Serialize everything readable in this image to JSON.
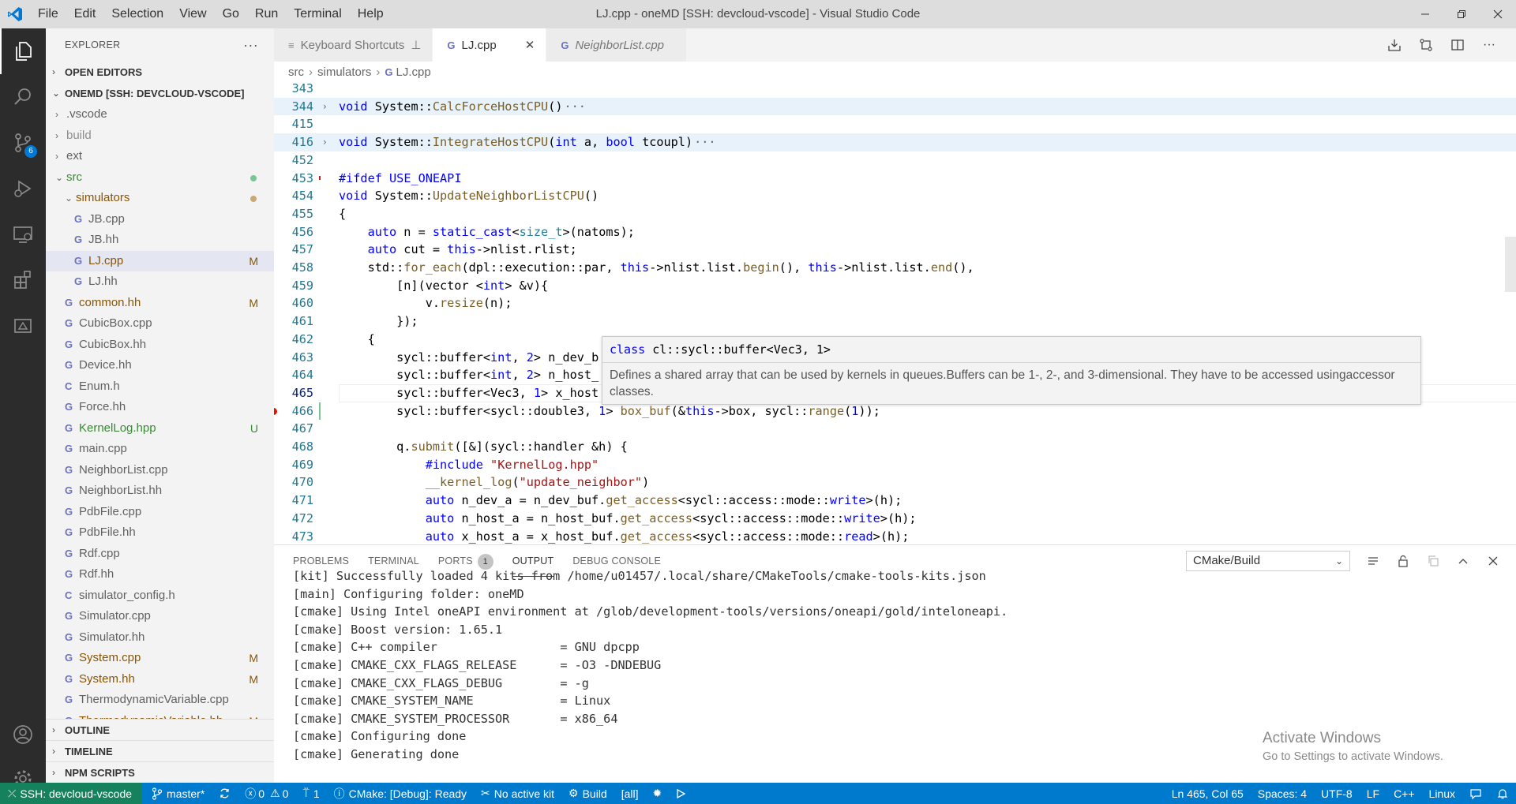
{
  "window": {
    "title": "LJ.cpp - oneMD [SSH: devcloud-vscode] - Visual Studio Code",
    "menu": [
      "File",
      "Edit",
      "Selection",
      "View",
      "Go",
      "Run",
      "Terminal",
      "Help"
    ]
  },
  "activity_bar": {
    "scm_badge": "6"
  },
  "explorer": {
    "title": "EXPLORER",
    "more": "···",
    "open_editors": "OPEN EDITORS",
    "workspace": "ONEMD [SSH: DEVCLOUD-VSCODE]",
    "items": [
      {
        "label": ".vscode",
        "type": "folder",
        "depth": 0,
        "color": "#616161",
        "status": ""
      },
      {
        "label": "build",
        "type": "folder",
        "depth": 0,
        "color": "#8e8e90",
        "status": ""
      },
      {
        "label": "ext",
        "type": "folder",
        "depth": 0,
        "color": "#616161",
        "status": ""
      },
      {
        "label": "src",
        "type": "folder-open",
        "depth": 0,
        "color": "#388a34",
        "status": "dot",
        "status_color": "#73c991"
      },
      {
        "label": "simulators",
        "type": "folder-open",
        "depth": 1,
        "color": "#895503",
        "status": "dot",
        "status_color": "#c9a973"
      },
      {
        "label": "JB.cpp",
        "type": "cpp",
        "depth": 2,
        "color": "#616161",
        "status": ""
      },
      {
        "label": "JB.hh",
        "type": "cpp",
        "depth": 2,
        "color": "#616161",
        "status": ""
      },
      {
        "label": "LJ.cpp",
        "type": "cpp",
        "depth": 2,
        "color": "#895503",
        "status": "M",
        "status_color": "#895503",
        "selected": true
      },
      {
        "label": "LJ.hh",
        "type": "cpp",
        "depth": 2,
        "color": "#616161",
        "status": ""
      },
      {
        "label": "common.hh",
        "type": "cpp",
        "depth": 1,
        "color": "#895503",
        "status": "M",
        "status_color": "#895503"
      },
      {
        "label": "CubicBox.cpp",
        "type": "cpp",
        "depth": 1,
        "color": "#616161",
        "status": ""
      },
      {
        "label": "CubicBox.hh",
        "type": "cpp",
        "depth": 1,
        "color": "#616161",
        "status": ""
      },
      {
        "label": "Device.hh",
        "type": "cpp",
        "depth": 1,
        "color": "#616161",
        "status": ""
      },
      {
        "label": "Enum.h",
        "type": "c",
        "depth": 1,
        "color": "#616161",
        "status": ""
      },
      {
        "label": "Force.hh",
        "type": "cpp",
        "depth": 1,
        "color": "#616161",
        "status": ""
      },
      {
        "label": "KernelLog.hpp",
        "type": "cpp",
        "depth": 1,
        "color": "#388a34",
        "status": "U",
        "status_color": "#388a34"
      },
      {
        "label": "main.cpp",
        "type": "cpp",
        "depth": 1,
        "color": "#616161",
        "status": ""
      },
      {
        "label": "NeighborList.cpp",
        "type": "cpp",
        "depth": 1,
        "color": "#616161",
        "status": ""
      },
      {
        "label": "NeighborList.hh",
        "type": "cpp",
        "depth": 1,
        "color": "#616161",
        "status": ""
      },
      {
        "label": "PdbFile.cpp",
        "type": "cpp",
        "depth": 1,
        "color": "#616161",
        "status": ""
      },
      {
        "label": "PdbFile.hh",
        "type": "cpp",
        "depth": 1,
        "color": "#616161",
        "status": ""
      },
      {
        "label": "Rdf.cpp",
        "type": "cpp",
        "depth": 1,
        "color": "#616161",
        "status": ""
      },
      {
        "label": "Rdf.hh",
        "type": "cpp",
        "depth": 1,
        "color": "#616161",
        "status": ""
      },
      {
        "label": "simulator_config.h",
        "type": "c",
        "depth": 1,
        "color": "#616161",
        "status": ""
      },
      {
        "label": "Simulator.cpp",
        "type": "cpp",
        "depth": 1,
        "color": "#616161",
        "status": ""
      },
      {
        "label": "Simulator.hh",
        "type": "cpp",
        "depth": 1,
        "color": "#616161",
        "status": ""
      },
      {
        "label": "System.cpp",
        "type": "cpp",
        "depth": 1,
        "color": "#895503",
        "status": "M",
        "status_color": "#895503"
      },
      {
        "label": "System.hh",
        "type": "cpp",
        "depth": 1,
        "color": "#895503",
        "status": "M",
        "status_color": "#895503"
      },
      {
        "label": "ThermodynamicVariable.cpp",
        "type": "cpp",
        "depth": 1,
        "color": "#616161",
        "status": ""
      },
      {
        "label": "ThermodynamicVariable.hh",
        "type": "cpp",
        "depth": 1,
        "color": "#895503",
        "status": "M",
        "status_color": "#895503"
      }
    ],
    "bottom_sections": [
      "OUTLINE",
      "TIMELINE",
      "NPM SCRIPTS"
    ]
  },
  "tabs": [
    {
      "label": "Keyboard Shortcuts",
      "icon": "≡",
      "active": false,
      "italic": false,
      "pin": true
    },
    {
      "label": "LJ.cpp",
      "icon": "G",
      "active": true,
      "italic": false,
      "close": "✕"
    },
    {
      "label": "NeighborList.cpp",
      "icon": "G",
      "active": false,
      "italic": true
    }
  ],
  "breadcrumb": {
    "parts": [
      "src",
      "simulators",
      "LJ.cpp"
    ]
  },
  "code": {
    "lines": [
      {
        "n": "343",
        "html": ""
      },
      {
        "n": "344",
        "fold": "›",
        "hl": true,
        "ellipsis": true,
        "html": "<span class='kw'>void</span> System::<span class='fn'>CalcForceHostCPU</span>()"
      },
      {
        "n": "415",
        "html": ""
      },
      {
        "n": "416",
        "fold": "›",
        "hl": true,
        "ellipsis": true,
        "html": "<span class='kw'>void</span> System::<span class='fn'>IntegrateHostCPU</span>(<span class='kw'>int</span> a, <span class='kw'>bool</span> tcoupl)"
      },
      {
        "n": "452",
        "html": ""
      },
      {
        "n": "453",
        "html": "<span class='pp'>#ifdef</span> <span class='pp'>USE_ONEAPI</span>"
      },
      {
        "n": "454",
        "html": "<span class='kw'>void</span> System::<span class='fn'>UpdateNeighborListCPU</span>()"
      },
      {
        "n": "455",
        "html": "{"
      },
      {
        "n": "456",
        "html": "    <span class='kw'>auto</span> n = <span class='kw'>static_cast</span>&lt;<span class='ty'>size_t</span>&gt;(natoms);"
      },
      {
        "n": "457",
        "html": "    <span class='kw'>auto</span> cut = <span class='kw'>this</span>-&gt;nlist.rlist;"
      },
      {
        "n": "458",
        "html": "    std::<span class='fn'>for_each</span>(dpl::execution::par, <span class='kw'>this</span>-&gt;nlist.list.<span class='fn'>begin</span>(), <span class='kw'>this</span>-&gt;nlist.list.<span class='fn'>end</span>(),"
      },
      {
        "n": "459",
        "html": "        [n](vector &lt;<span class='kw'>int</span>&gt; &amp;v){"
      },
      {
        "n": "460",
        "html": "            v.<span class='fn'>resize</span>(n);"
      },
      {
        "n": "461",
        "html": "        });"
      },
      {
        "n": "462",
        "html": "    {"
      },
      {
        "n": "463",
        "html": "        sycl::buffer&lt;<span class='kw'>int</span>, <span class='kw'>2</span>&gt; n_dev_b"
      },
      {
        "n": "464",
        "html": "        sycl::buffer&lt;<span class='kw'>int</span>, <span class='kw'>2</span>&gt; n_host_"
      },
      {
        "n": "465",
        "cur": true,
        "html": "        sycl::buffer&lt;Vec3, <span class='kw'>1</span>&gt; x_host"
      },
      {
        "n": "466",
        "bp": true,
        "html": "        sycl::buffer&lt;sycl::double3, <span class='kw'>1</span>&gt; <span class='fn'>box_buf</span>(&amp;<span class='kw'>this</span>-&gt;box, sycl::<span class='fn'>range</span>(<span class='kw'>1</span>));"
      },
      {
        "n": "467",
        "html": ""
      },
      {
        "n": "468",
        "html": "        q.<span class='fn'>submit</span>([&amp;](sycl::handler &amp;h) {"
      },
      {
        "n": "469",
        "html": "            <span class='pp'>#include</span> <span class='st'>\"KernelLog.hpp\"</span>"
      },
      {
        "n": "470",
        "html": "            <span class='fn'>__kernel_log</span>(<span class='st'>\"update_neighbor\"</span>)"
      },
      {
        "n": "471",
        "html": "            <span class='kw'>auto</span> n_dev_a = n_dev_buf.<span class='fn'>get_access</span>&lt;sycl::access::mode::<span class='kw'>write</span>&gt;(h);"
      },
      {
        "n": "472",
        "html": "            <span class='kw'>auto</span> n_host_a = n_host_buf.<span class='fn'>get_access</span>&lt;sycl::access::mode::<span class='kw'>write</span>&gt;(h);"
      },
      {
        "n": "473",
        "html": "            <span class='kw'>auto</span> x_host_a = x_host_buf.<span class='fn'>get_access</span>&lt;sycl::access::mode::<span class='kw'>read</span>&gt;(h);"
      }
    ]
  },
  "hover": {
    "sig_kw": "class",
    "sig": "cl::sycl::buffer<Vec3, 1>",
    "doc": "Defines a shared array that can be used by kernels in queues.Buffers can be 1-, 2-, and 3-dimensional. They have to be accessed usingaccessor classes."
  },
  "panel": {
    "tabs": [
      {
        "label": "PROBLEMS"
      },
      {
        "label": "TERMINAL"
      },
      {
        "label": "PORTS",
        "badge": "1"
      },
      {
        "label": "OUTPUT",
        "active": true
      },
      {
        "label": "DEBUG CONSOLE"
      }
    ],
    "select": "CMake/Build",
    "log": [
      "[kit] Successfully loaded 4 kits from /home/u01457/.local/share/CMakeTools/cmake-tools-kits.json",
      "[main] Configuring folder: oneMD",
      "[cmake] Using Intel oneAPI environment at /glob/development-tools/versions/oneapi/gold/inteloneapi.",
      "[cmake] Boost version: 1.65.1",
      "[cmake] C++ compiler                 = GNU dpcpp",
      "[cmake] CMAKE_CXX_FLAGS_RELEASE      = -O3 -DNDEBUG",
      "[cmake] CMAKE_CXX_FLAGS_DEBUG        = -g",
      "[cmake] CMAKE_SYSTEM_NAME            = Linux",
      "[cmake] CMAKE_SYSTEM_PROCESSOR       = x86_64",
      "[cmake] Configuring done",
      "[cmake] Generating done"
    ]
  },
  "watermark": {
    "title": "Activate Windows",
    "sub": "Go to Settings to activate Windows."
  },
  "statusbar": {
    "remote": "SSH: devcloud-vscode",
    "branch": "master*",
    "errors": "0",
    "warnings": "0",
    "ports": "1",
    "cmake": "CMake: [Debug]: Ready",
    "kit": "No active kit",
    "build": "Build",
    "target": "[all]",
    "position": "Ln 465, Col 65",
    "spaces": "Spaces: 4",
    "encoding": "UTF-8",
    "eol": "LF",
    "language": "C++",
    "os": "Linux"
  },
  "colors": {
    "accent": "#007acc",
    "remote": "#16825d",
    "activity": "#2c2c2c"
  }
}
